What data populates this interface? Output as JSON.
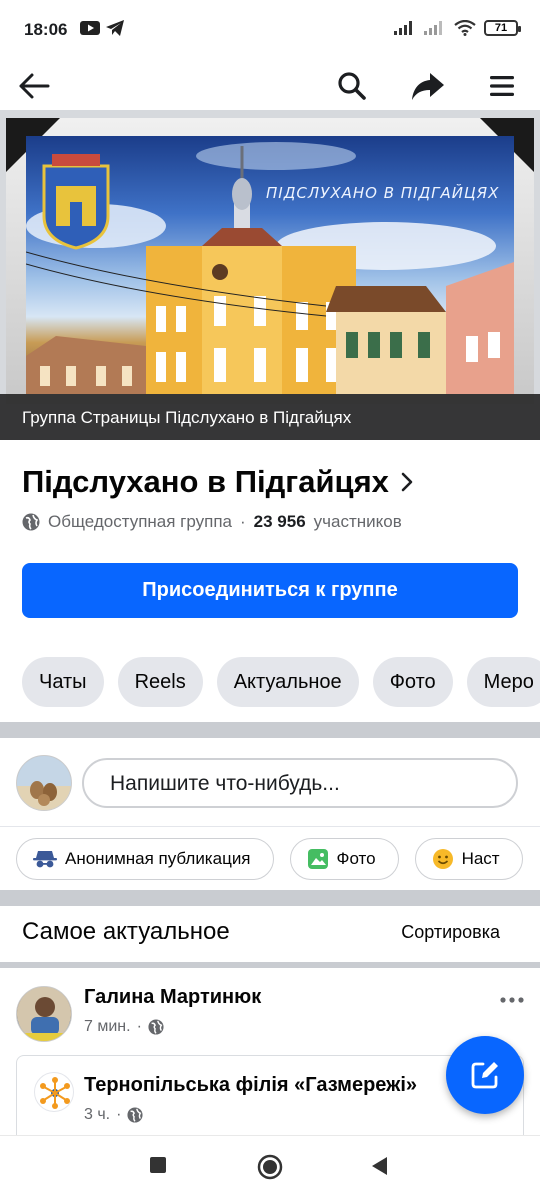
{
  "status_bar": {
    "time": "18:06",
    "battery": "71"
  },
  "cover": {
    "overlay_text": "ПІДСЛУХАНО В ПІДГАЙЦЯХ",
    "caption": "Группа Страницы Підслухано в Підгайцях"
  },
  "group": {
    "name": "Підслухано в Підгайцях",
    "privacy": "Общедоступная группа",
    "separator": "·",
    "members_count": "23 956",
    "members_label": "участников",
    "join_label": "Присоединиться к группе"
  },
  "tabs": [
    "Чаты",
    "Reels",
    "Актуальное",
    "Фото",
    "Меро"
  ],
  "composer": {
    "placeholder": "Напишите что-нибудь...",
    "chips": [
      {
        "label": "Анонимная публикация",
        "icon": "incognito-icon"
      },
      {
        "label": "Фото",
        "icon": "photo-icon"
      },
      {
        "label": "Наст",
        "icon": "smiley-icon"
      }
    ]
  },
  "feed": {
    "title": "Самое актуальное",
    "sort_label": "Сортировка"
  },
  "post": {
    "author": "Галина Мартинюк",
    "time": "7 мин.",
    "dot": "·",
    "more": "•••",
    "shared": {
      "name": "Тернопільська філія «Газмережі»",
      "time": "3 ч.",
      "dot": "·"
    }
  },
  "colors": {
    "accent": "#0866ff",
    "chip_bg": "#e4e6eb",
    "secondary_text": "#65676b",
    "caption_bg": "#282828"
  }
}
